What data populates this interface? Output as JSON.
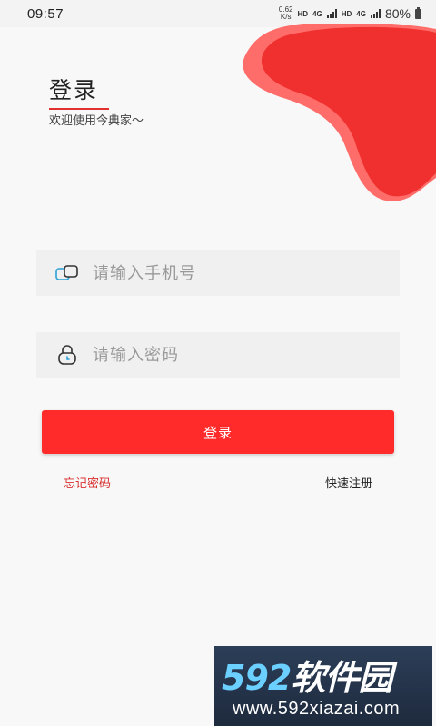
{
  "status_bar": {
    "time": "09:57",
    "net_speed_value": "0.62",
    "net_speed_unit": "K/s",
    "hd1": "HD",
    "sig1_tag": "4G",
    "hd2": "HD",
    "sig2_tag": "4G",
    "battery": "80%"
  },
  "login": {
    "title": "登录",
    "welcome": "欢迎使用今典家～",
    "phone_placeholder": "请输入手机号",
    "password_placeholder": "请输入密码",
    "login_button": "登录",
    "forgot_password": "忘记密码",
    "quick_register": "快速注册"
  },
  "watermark": {
    "logo_digits": "592",
    "logo_text": "软件园",
    "url": "www.592xiazai.com"
  },
  "colors": {
    "accent": "#ff2a2a",
    "blob": "#f0302f",
    "link_red": "#d93030",
    "background": "#f8f8f8"
  },
  "icons": [
    "phone-icon",
    "lock-icon",
    "signal-icon",
    "battery-icon"
  ]
}
